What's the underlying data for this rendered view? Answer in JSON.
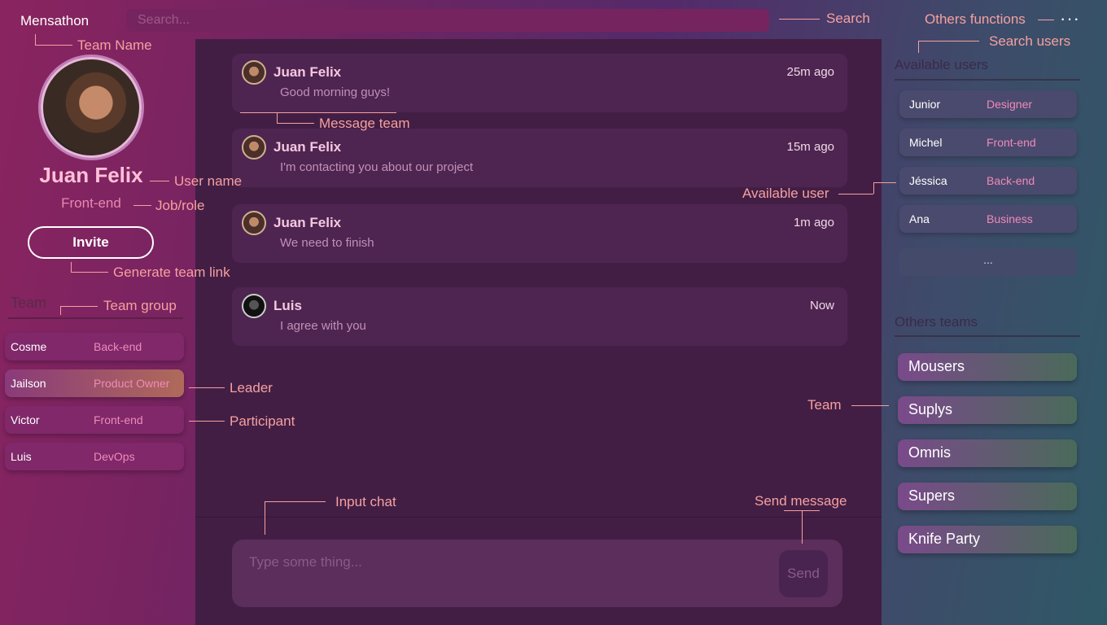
{
  "app": {
    "team_name": "Mensathon"
  },
  "search": {
    "placeholder": "Search..."
  },
  "more_glyph": "···",
  "profile": {
    "user_name": "Juan Felix",
    "role": "Front-end",
    "invite_label": "Invite"
  },
  "team": {
    "title": "Team",
    "members": [
      {
        "name": "Cosme",
        "role": "Back-end"
      },
      {
        "name": "Jailson",
        "role": "Product Owner"
      },
      {
        "name": "Victor",
        "role": "Front-end"
      },
      {
        "name": "Luis",
        "role": "DevOps"
      }
    ]
  },
  "messages": [
    {
      "author": "Juan Felix",
      "time": "25m ago",
      "text": "Good morning guys!"
    },
    {
      "author": "Juan Felix",
      "time": "15m ago",
      "text": "I'm contacting you about our project"
    },
    {
      "author": "Juan Felix",
      "time": "1m ago",
      "text": "We need to finish"
    },
    {
      "author": "Luis",
      "time": "Now",
      "text": "I agree with you"
    }
  ],
  "chat_input": {
    "placeholder": "Type some thing...",
    "send_label": "Send"
  },
  "available_users": {
    "title": "Available users",
    "users": [
      {
        "name": "Junior",
        "role": "Designer"
      },
      {
        "name": "Michel",
        "role": "Front-end"
      },
      {
        "name": "Jéssica",
        "role": "Back-end"
      },
      {
        "name": "Ana",
        "role": "Business"
      }
    ],
    "more": "..."
  },
  "other_teams": {
    "title": "Others teams",
    "teams": [
      "Mousers",
      "Suplys",
      "Omnis",
      "Supers",
      "Knife Party"
    ]
  },
  "annotations": {
    "team_name": "Team Name",
    "search": "Search",
    "others_functions": "Others functions",
    "search_users": "Search users",
    "user_name": "User name",
    "job_role": "Job/role",
    "generate_team_link": "Generate team link",
    "team_group": "Team group",
    "leader": "Leader",
    "participant": "Participant",
    "message_team": "Message team",
    "available_user": "Available user",
    "team": "Team",
    "input_chat": "Input chat",
    "send_message": "Send message"
  }
}
